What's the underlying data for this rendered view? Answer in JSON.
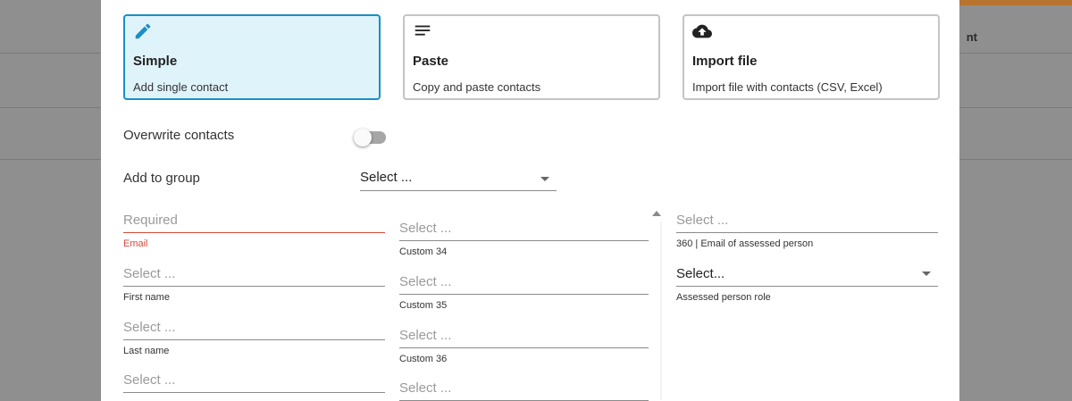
{
  "background": {
    "header_right_text": "nt"
  },
  "cards": [
    {
      "icon": "pencil-icon",
      "title": "Simple",
      "description": "Add single contact",
      "selected": true
    },
    {
      "icon": "lines-icon",
      "title": "Paste",
      "description": "Copy and paste contacts",
      "selected": false
    },
    {
      "icon": "cloud-upload-icon",
      "title": "Import file",
      "description": "Import file with contacts (CSV, Excel)",
      "selected": false
    }
  ],
  "overwrite": {
    "label": "Overwrite contacts",
    "enabled": false
  },
  "group": {
    "label": "Add to group",
    "value": "Select ..."
  },
  "columns": {
    "left": [
      {
        "placeholder": "Required",
        "label": "Email",
        "error": true
      },
      {
        "placeholder": "Select ...",
        "label": "First name"
      },
      {
        "placeholder": "Select ...",
        "label": "Last name"
      },
      {
        "placeholder": "Select ...",
        "label": ""
      }
    ],
    "middle": [
      {
        "placeholder": "Select ...",
        "label": "Custom 34"
      },
      {
        "placeholder": "Select ...",
        "label": "Custom 35"
      },
      {
        "placeholder": "Select ...",
        "label": "Custom 36"
      },
      {
        "placeholder": "Select ...",
        "label": ""
      }
    ],
    "right": [
      {
        "placeholder": "Select ...",
        "label": "360 | Email of assessed person"
      },
      {
        "value": "Select...",
        "label": "Assessed person role"
      }
    ]
  },
  "colors": {
    "selected_card_bg": "#dff3fb",
    "selected_card_border": "#1a8fc4",
    "error": "#d24a3a",
    "accent_orange": "#b8742f"
  }
}
